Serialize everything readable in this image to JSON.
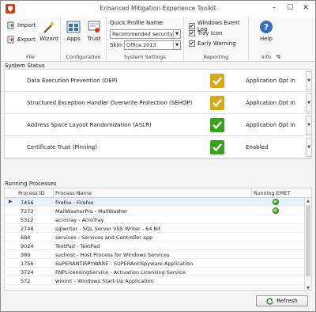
{
  "window": {
    "title": "Enhanced Mitigation Experience Toolkit",
    "minimize": "–",
    "maximize": "☐",
    "close": "✕"
  },
  "ribbon": {
    "file": {
      "label": "File",
      "import": "Import",
      "export": "Export",
      "wizard": "Wizard"
    },
    "configuration": {
      "label": "Configuration",
      "apps": "Apps",
      "trust": "Trust"
    },
    "system_settings": {
      "label": "System Settings",
      "quick_profile_label": "Quick Profile Name:",
      "quick_profile_value": "Recommended security ...",
      "skin_label": "Skin:",
      "skin_value": "Office 2013"
    },
    "reporting": {
      "label": "Reporting",
      "items": [
        {
          "label": "Windows Event Log",
          "checked": "✔"
        },
        {
          "label": "Tray Icon",
          "checked": "✔"
        },
        {
          "label": "Early Warning",
          "checked": "✔"
        }
      ]
    },
    "info": {
      "label": "Info",
      "help": "Help"
    }
  },
  "system_status": {
    "title": "System Status",
    "rows": [
      {
        "name": "Data Execution Prevention (DEP)",
        "status": "warning",
        "value": "Application Opt In"
      },
      {
        "name": "Structured Exception Handler Overwrite Protection (SEHOP)",
        "status": "warning",
        "value": "Application Opt In"
      },
      {
        "name": "Address Space Layout Randomization (ASLR)",
        "status": "ok",
        "value": "Application Opt In"
      },
      {
        "name": "Certificate Trust (Pinning)",
        "status": "ok",
        "value": "Enabled"
      }
    ],
    "colors": {
      "warning": "#d9a91b",
      "ok": "#3aa21f"
    }
  },
  "running_processes": {
    "title": "Running Processes",
    "columns": [
      "Process ID",
      "Process Name",
      "Running EMET"
    ],
    "rows": [
      {
        "pid": "7456",
        "name": "firefox - Firefox",
        "emet": "yes",
        "selected": "yes"
      },
      {
        "pid": "7272",
        "name": "MailWasherPro - MailWasher",
        "emet": "yes"
      },
      {
        "pid": "5312",
        "name": "acrotray - AcroTray"
      },
      {
        "pid": "2748",
        "name": "sqlwriter - SQL Server VSS Writer - 64 Bit"
      },
      {
        "pid": "684",
        "name": "services - Services and Controller app"
      },
      {
        "pid": "9024",
        "name": "TextPad - TextPad"
      },
      {
        "pid": "380",
        "name": "svchost - Host Process for Windows Services"
      },
      {
        "pid": "1756",
        "name": "SUPERANTISPYWARE - SUPERAntiSpyware Application"
      },
      {
        "pid": "3724",
        "name": "FNPLicensingService - Activation Licensing Service"
      },
      {
        "pid": "572",
        "name": "wininit - Windows Start-Up Application"
      }
    ],
    "refresh_label": "Refresh"
  }
}
